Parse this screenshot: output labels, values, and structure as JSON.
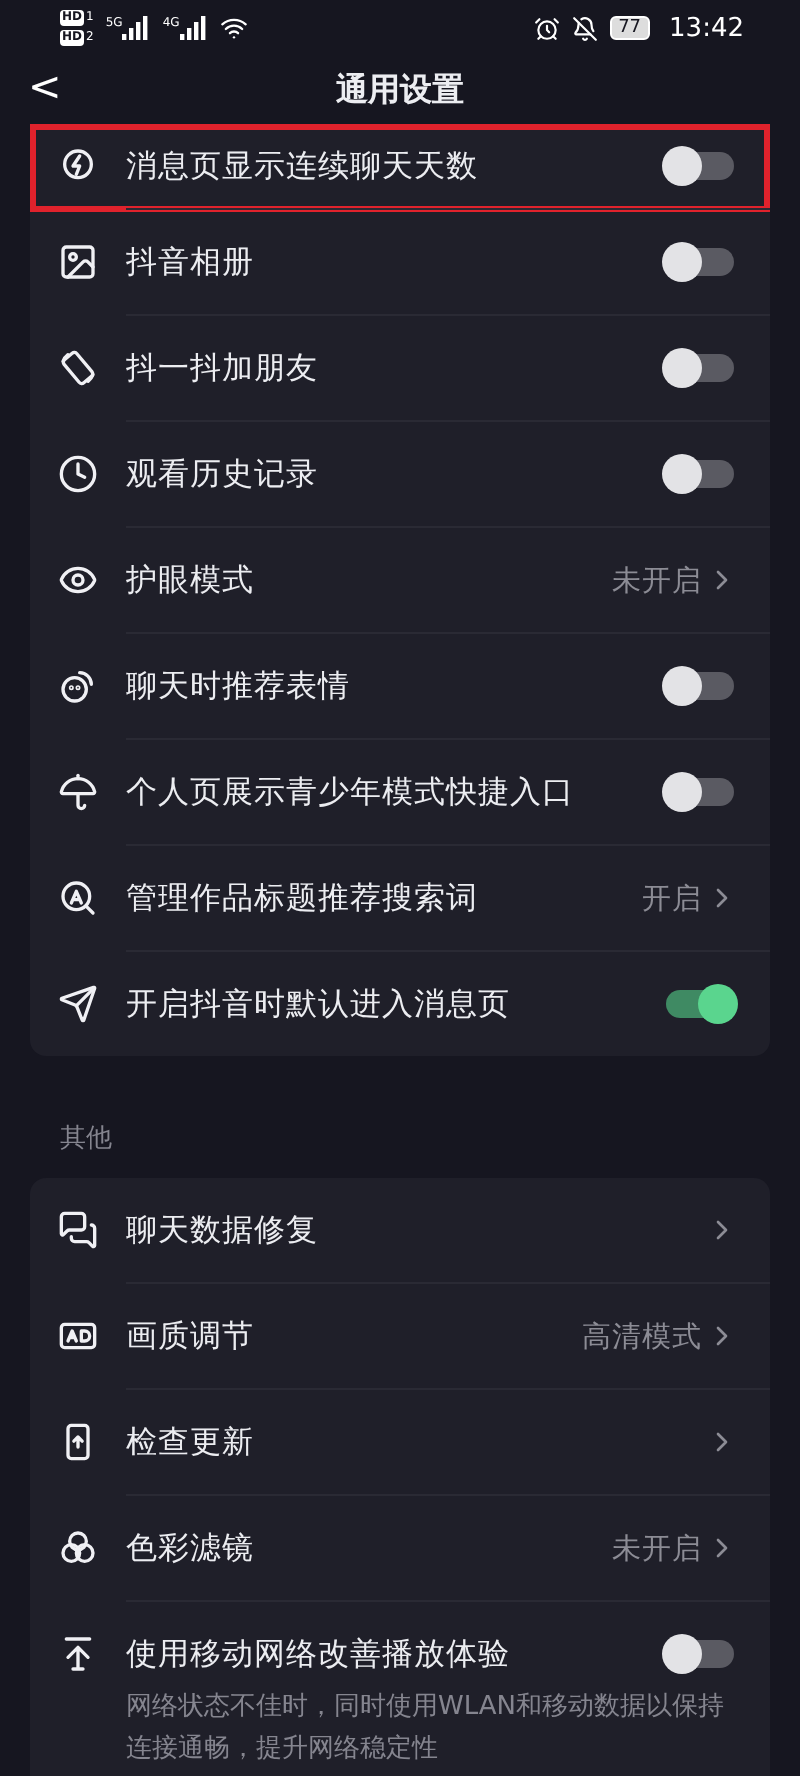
{
  "status_bar": {
    "sims": [
      {
        "badge": "HD",
        "slot": "1",
        "network": "5G"
      },
      {
        "badge": "HD",
        "slot": "2",
        "network": "4G"
      }
    ],
    "battery": "77",
    "time": "13:42"
  },
  "header": {
    "back": "<",
    "title": "通用设置"
  },
  "sections": [
    {
      "rows": [
        {
          "kind": "toggle",
          "label": "消息页显示连续聊天天数",
          "on": false,
          "highlighted": true
        },
        {
          "kind": "toggle",
          "label": "抖音相册",
          "on": false,
          "highlighted": false
        },
        {
          "kind": "toggle",
          "label": "抖一抖加朋友",
          "on": false,
          "highlighted": false
        },
        {
          "kind": "toggle",
          "label": "观看历史记录",
          "on": false,
          "highlighted": false
        },
        {
          "kind": "link",
          "label": "护眼模式",
          "value": "未开启",
          "highlighted": false
        },
        {
          "kind": "toggle",
          "label": "聊天时推荐表情",
          "on": false,
          "highlighted": false
        },
        {
          "kind": "toggle",
          "label": "个人页展示青少年模式快捷入口",
          "on": false,
          "highlighted": false
        },
        {
          "kind": "link",
          "label": "管理作品标题推荐搜索词",
          "value": "开启",
          "highlighted": false
        },
        {
          "kind": "toggle",
          "label": "开启抖音时默认进入消息页",
          "on": true,
          "highlighted": false
        }
      ]
    },
    {
      "title": "其他",
      "rows": [
        {
          "kind": "link",
          "label": "聊天数据修复",
          "highlighted": false
        },
        {
          "kind": "link",
          "label": "画质调节",
          "value": "高清模式",
          "highlighted": false
        },
        {
          "kind": "link",
          "label": "检查更新",
          "highlighted": false
        },
        {
          "kind": "link",
          "label": "色彩滤镜",
          "value": "未开启",
          "highlighted": false
        },
        {
          "kind": "toggle",
          "label": "使用移动网络改善播放体验",
          "on": false,
          "description": "网络状态不佳时，同时使用WLAN和移动数据以保持连接通畅，提升网络稳定性",
          "highlighted": false
        }
      ]
    }
  ]
}
